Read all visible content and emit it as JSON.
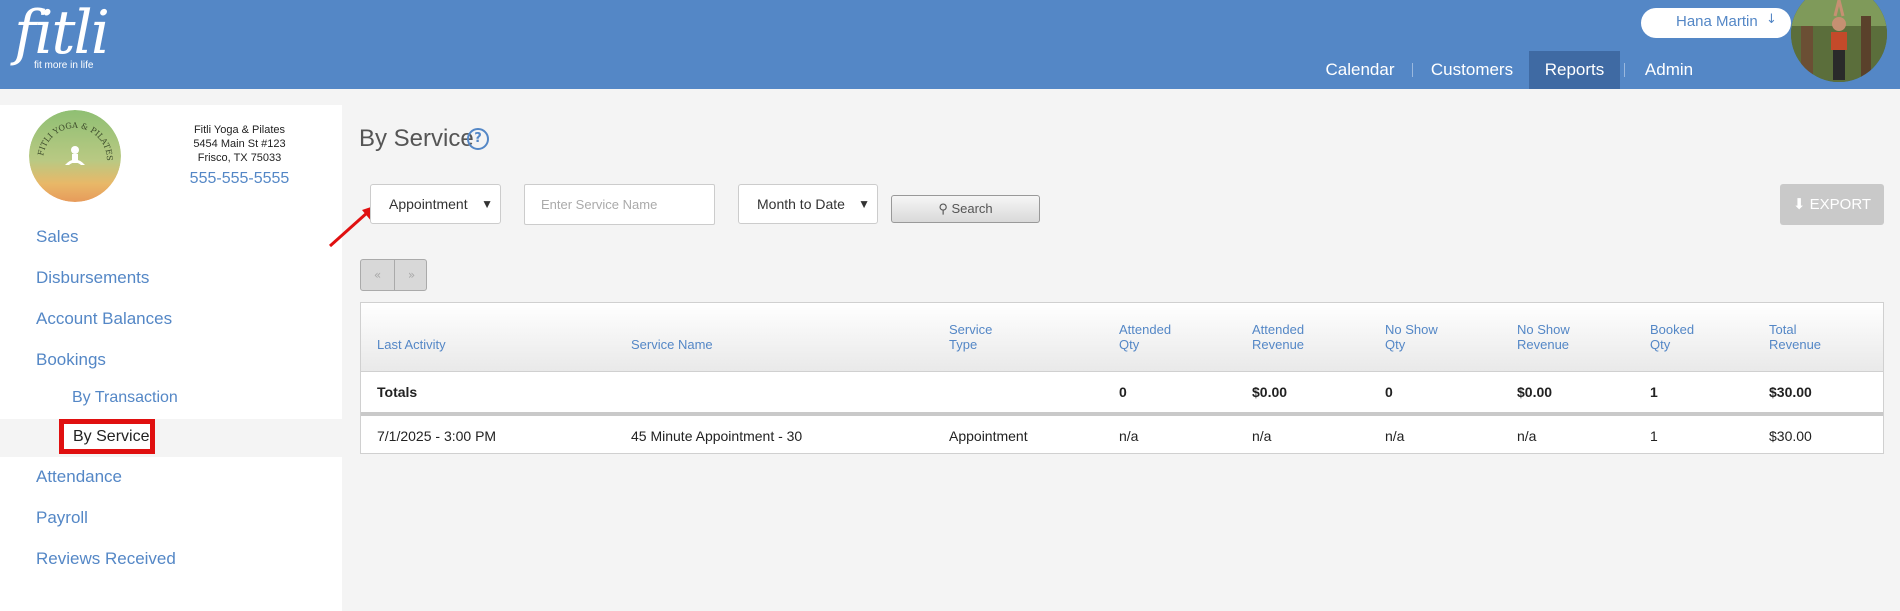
{
  "header": {
    "logo_text": "fitli",
    "logo_tagline": "fit more in life",
    "user_name": "Hana Martin",
    "nav": [
      "Calendar",
      "Customers",
      "Reports",
      "Admin"
    ],
    "active_nav": "Reports"
  },
  "studio": {
    "name": "Fitli Yoga & Pilates",
    "address1": "5454 Main St #123",
    "address2": "Frisco, TX 75033",
    "phone": "555-555-5555",
    "logo_text": "FITLI YOGA & PILATES"
  },
  "sidebar": {
    "items": [
      {
        "label": "Sales"
      },
      {
        "label": "Disbursements"
      },
      {
        "label": "Account Balances"
      },
      {
        "label": "Bookings"
      },
      {
        "label": "By Transaction"
      },
      {
        "label": "By Service"
      },
      {
        "label": "Attendance"
      },
      {
        "label": "Payroll"
      },
      {
        "label": "Reviews Received"
      }
    ],
    "active": "By Service"
  },
  "main": {
    "title": "By Service",
    "help_glyph": "?",
    "filters": {
      "type_select": "Appointment",
      "service_placeholder": "Enter Service Name",
      "date_range_select": "Month to Date",
      "search_label": "Search",
      "export_label": "EXPORT"
    },
    "pager": {
      "prev": "«",
      "next": "»"
    },
    "table": {
      "columns": [
        [
          "Last Activity",
          ""
        ],
        [
          "Service Name",
          ""
        ],
        [
          "Service",
          "Type"
        ],
        [
          "Attended",
          "Qty"
        ],
        [
          "Attended",
          "Revenue"
        ],
        [
          "No Show",
          "Qty"
        ],
        [
          "No Show",
          "Revenue"
        ],
        [
          "Booked",
          "Qty"
        ],
        [
          "Total",
          "Revenue"
        ]
      ],
      "totals": [
        "Totals",
        "",
        "",
        "0",
        "$0.00",
        "0",
        "$0.00",
        "1",
        "$30.00"
      ],
      "rows": [
        [
          "7/1/2025 - 3:00 PM",
          "45 Minute Appointment - 30",
          "Appointment",
          "n/a",
          "n/a",
          "n/a",
          "n/a",
          "1",
          "$30.00"
        ]
      ]
    }
  },
  "colors": {
    "brand": "#5487c6",
    "nav_active": "#3f6aa3",
    "highlight_box": "#e01010",
    "annotation_arrow": "#e01010"
  }
}
